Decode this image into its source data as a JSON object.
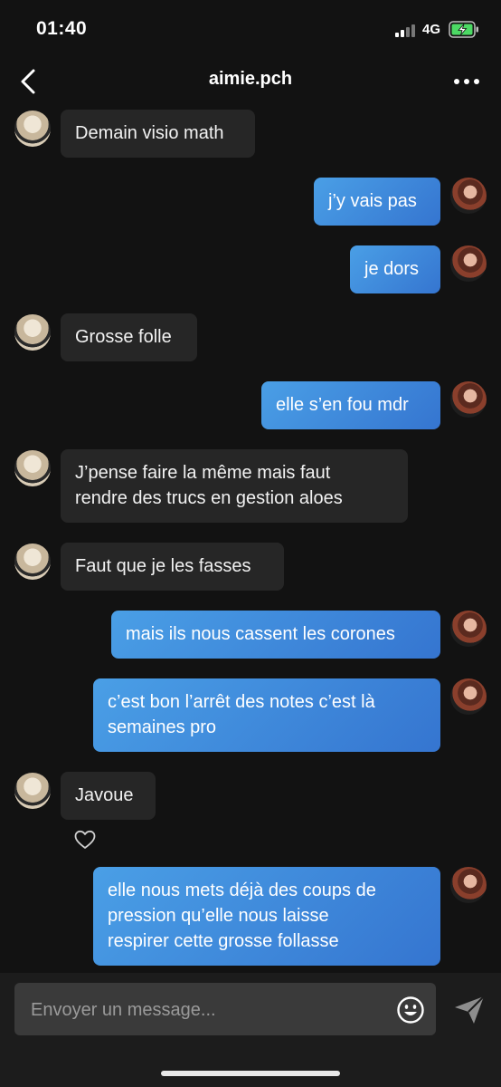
{
  "status_bar": {
    "time": "01:40",
    "network": "4G"
  },
  "header": {
    "title": "aimie.pch",
    "back_icon": "chevron-left-icon",
    "more_icon": "more-horizontal-icon"
  },
  "messages": [
    {
      "from": "them",
      "text": "Demain visio math"
    },
    {
      "from": "me",
      "text": "j’y vais pas"
    },
    {
      "from": "me",
      "text": "je dors"
    },
    {
      "from": "them",
      "text": "Grosse folle"
    },
    {
      "from": "me",
      "text": "elle s’en fou mdr"
    },
    {
      "from": "them",
      "lines": [
        "J’pense faire la même mais faut",
        "rendre des trucs en gestion aloes"
      ]
    },
    {
      "from": "them",
      "text": "Faut que je les fasses"
    },
    {
      "from": "me",
      "text": "mais ils nous cassent les corones"
    },
    {
      "from": "me",
      "lines": [
        "c’est bon l’arrêt des notes c’est là",
        "semaines pro"
      ]
    },
    {
      "from": "them",
      "text": "Javoue",
      "liked": true
    },
    {
      "from": "me",
      "lines": [
        "elle nous mets déjà des coups de",
        "pression qu’elle nous laisse",
        "respirer cette grosse follasse"
      ]
    }
  ],
  "composer": {
    "placeholder": "Envoyer un message...",
    "emoji_icon": "smile-icon",
    "send_icon": "send-icon"
  },
  "colors": {
    "background": "#121212",
    "received_bubble": "#262626",
    "sent_gradient_start": "#4a9fe6",
    "sent_gradient_end": "#3575d0",
    "battery_charging": "#4cd964"
  }
}
